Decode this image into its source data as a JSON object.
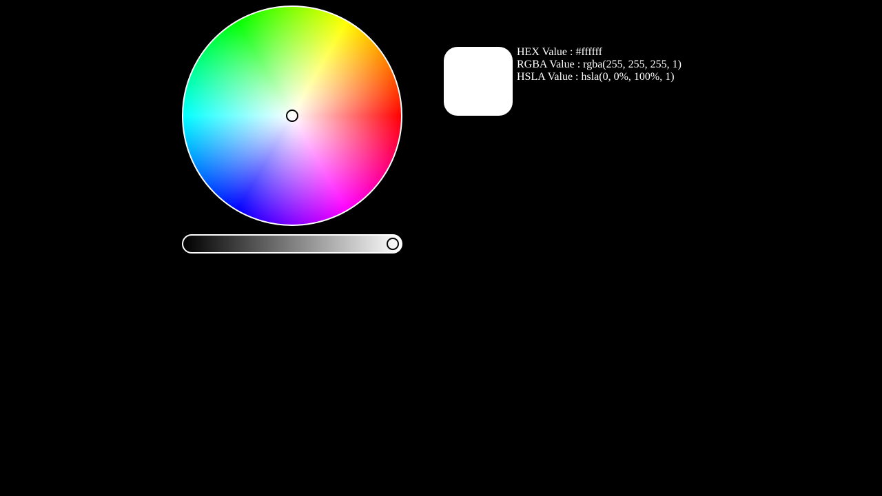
{
  "picker": {
    "wheel_icon": "color-wheel",
    "slider_icon": "lightness-slider",
    "lightness": 1.0,
    "selected_color": "#ffffff"
  },
  "values": {
    "hex": "HEX Value : #ffffff",
    "rgba": "RGBA Value : rgba(255, 255, 255, 1)",
    "hsla": "HSLA Value : hsla(0, 0%, 100%, 1)"
  }
}
